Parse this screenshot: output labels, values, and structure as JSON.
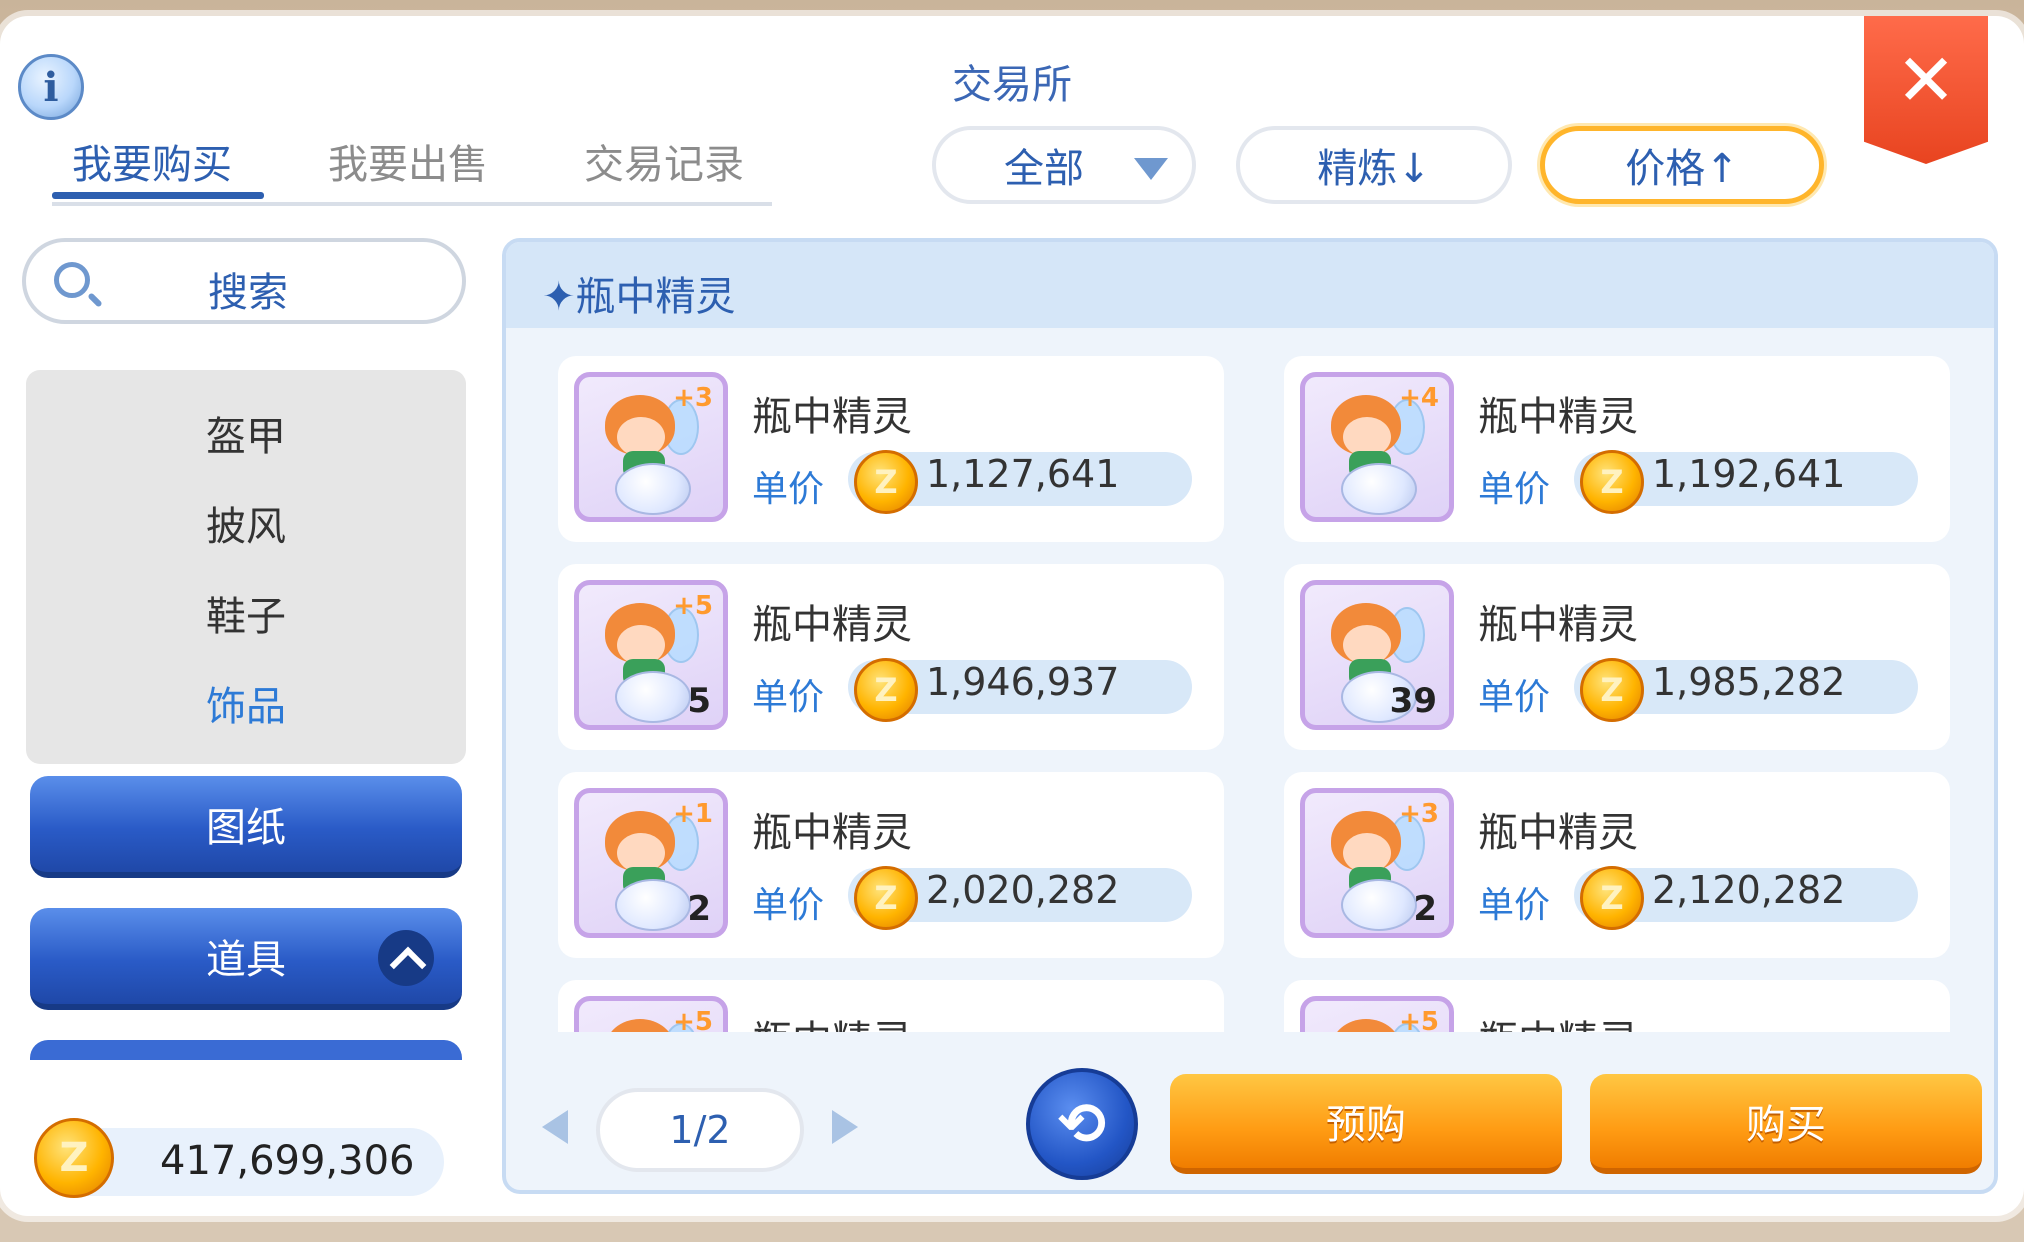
{
  "title": "交易所",
  "tabs": [
    {
      "label": "我要购买",
      "active": true
    },
    {
      "label": "我要出售",
      "active": false
    },
    {
      "label": "交易记录",
      "active": false
    }
  ],
  "filters": {
    "category": "全部",
    "refine_sort": "精炼↓",
    "price_sort": "价格↑"
  },
  "search": {
    "label": "搜索"
  },
  "categories": [
    {
      "label": "盔甲"
    },
    {
      "label": "披风"
    },
    {
      "label": "鞋子"
    },
    {
      "label": "饰品",
      "active": true
    }
  ],
  "side_buttons": {
    "blueprint": "图纸",
    "items": "道具"
  },
  "wallet": {
    "balance": "417,699,306"
  },
  "list_header": "✦瓶中精灵",
  "price_label": "单价",
  "listings": [
    {
      "name": "瓶中精灵",
      "refine": "+3",
      "qty": "",
      "price": "1,127,641"
    },
    {
      "name": "瓶中精灵",
      "refine": "+4",
      "qty": "",
      "price": "1,192,641"
    },
    {
      "name": "瓶中精灵",
      "refine": "+5",
      "qty": "5",
      "price": "1,946,937"
    },
    {
      "name": "瓶中精灵",
      "refine": "",
      "qty": "39",
      "price": "1,985,282"
    },
    {
      "name": "瓶中精灵",
      "refine": "+1",
      "qty": "2",
      "price": "2,020,282"
    },
    {
      "name": "瓶中精灵",
      "refine": "+3",
      "qty": "2",
      "price": "2,120,282"
    },
    {
      "name": "瓶中精灵",
      "refine": "+5",
      "qty": "",
      "price": ""
    },
    {
      "name": "瓶中精灵",
      "refine": "+5",
      "qty": "",
      "price": ""
    }
  ],
  "pager": {
    "text": "1/2"
  },
  "actions": {
    "preorder": "预购",
    "buy": "购买"
  },
  "colors": {
    "accent_blue": "#2d5fb0",
    "orange_button": "#ff9b13",
    "close_red": "#e84420",
    "selected_filter_border": "#ffb52b"
  }
}
